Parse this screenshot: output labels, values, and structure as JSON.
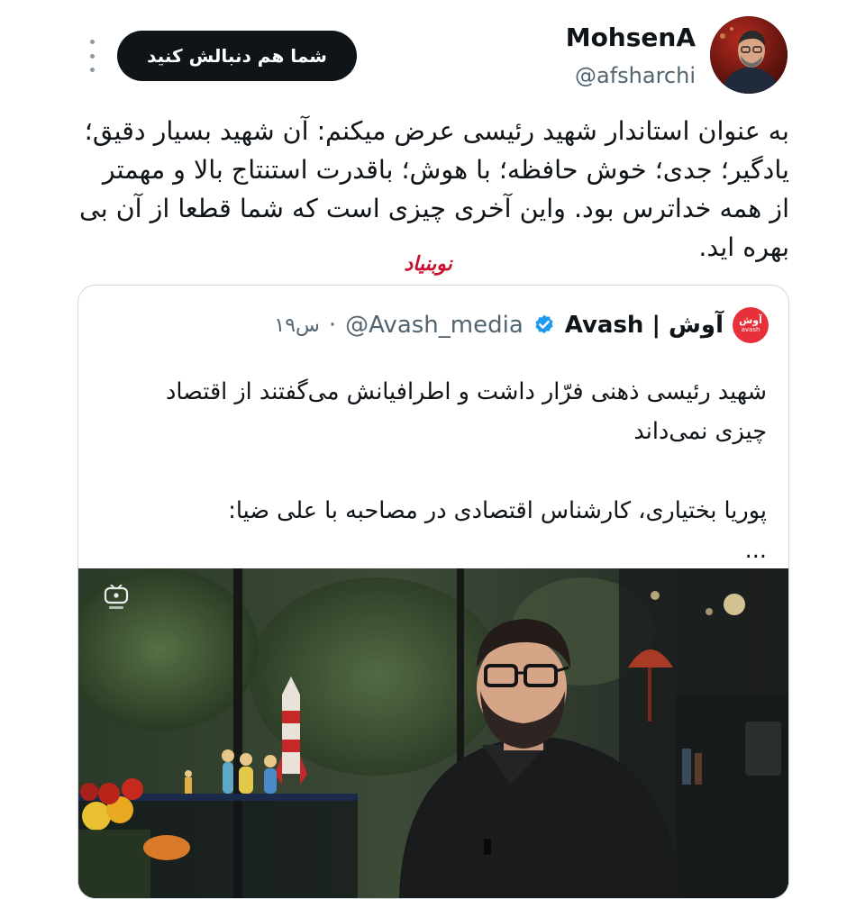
{
  "header": {
    "more_icon": "kebab-menu-icon",
    "follow_label": "شما هم دنبالش کنید",
    "author_name": "MohsenA",
    "author_handle": "@afsharchi"
  },
  "tweet": {
    "text": "به عنوان استاندار شهید رئیسی عرض میکنم: آن شهید بسیار دقیق؛ یادگیر؛ جدی؛ خوش حافظه؛ با هوش؛ باقدرت استنتاج بالا و مهمتر از همه خداترس بود. واین آخری چیزی است که شما قطعا از آن بی بهره اید."
  },
  "watermark": {
    "text": "نوبنیاد",
    "color": "#c8102e"
  },
  "quote": {
    "logo_text": "آوش",
    "logo_sub": "avash",
    "name": "Avash | آوش",
    "handle": "@Avash_media",
    "separator": "·",
    "time": "۱۹س",
    "verified_icon": "verified-badge-icon",
    "paragraph_1": "شهید رئیسی ذهنی فرّار داشت و اطرافیانش می‌گفتند از اقتصاد چیزی نمی‌داند",
    "paragraph_2": "پوریا بختیاری، کارشناس اقتصادی در مصاحبه با علی ضیا:",
    "ellipsis": "...",
    "video_icon": "tv-channel-logo-icon"
  },
  "colors": {
    "text_primary": "#0f1419",
    "text_secondary": "#536471",
    "border": "#cfd9de",
    "verified_blue": "#1d9bf0",
    "avash_red": "#e8303a"
  }
}
